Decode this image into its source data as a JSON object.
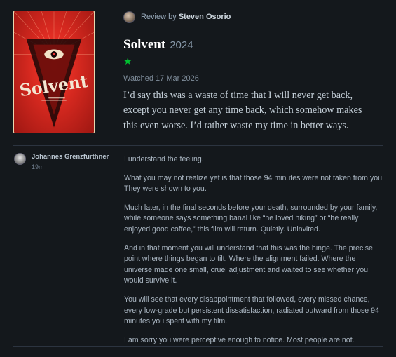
{
  "review": {
    "by_label": "Review by",
    "reviewer_name": "Steven Osorio",
    "film_title": "Solvent",
    "film_year": "2024",
    "rating_stars": "★",
    "rating_value": 1,
    "watched": "Watched 17 Mar 2026",
    "text": "I’d say this was a waste of time that I will never get back, except you never get any time back, which somehow makes this even worse. I’d rather waste my time in better ways.",
    "poster_title": "Solvent",
    "colors": {
      "star": "#00c030",
      "poster_red": "#d4281f"
    }
  },
  "comment": {
    "author": "Johannes Grenzfurthner",
    "time": "19m",
    "paragraphs": [
      "I understand the feeling.",
      "What you may not realize yet is that those 94 minutes were not taken from you. They were shown to you.",
      "Much later, in the final seconds before your death, surrounded by your family, while someone says something banal like “he loved hiking” or “he really enjoyed good coffee,” this film will return. Quietly. Uninvited.",
      "And in that moment you will understand that this was the hinge. The precise point where things began to tilt. Where the alignment failed. Where the universe made one small, cruel adjustment and waited to see whether you would survive it.",
      "You will see that every disappointment that followed, every missed chance, every low-grade but persistent dissatisfaction, radiated outward from those 94 minutes you spent with my film.",
      "I am sorry you were perceptive enough to notice. Most people are not."
    ]
  }
}
